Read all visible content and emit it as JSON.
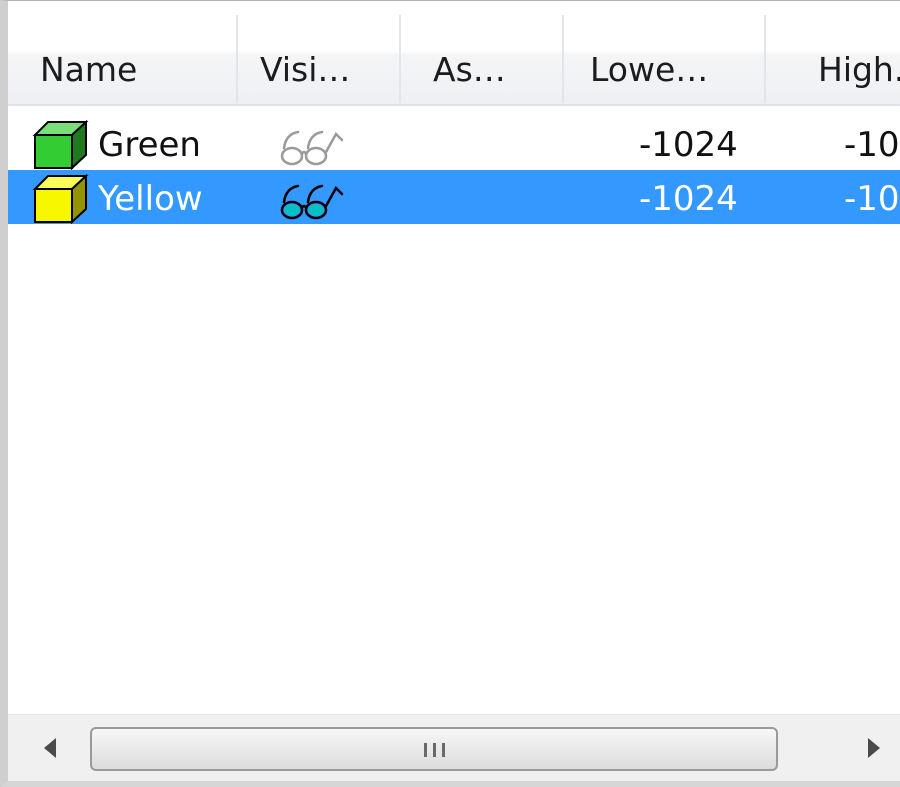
{
  "columns": {
    "name": "Name",
    "visible": "Visi…",
    "assigned": "As…",
    "lower": "Lowe…",
    "higher": "High."
  },
  "rows": [
    {
      "name": "Green",
      "lower": "-1024",
      "higher": "-10",
      "color": "#33cc33",
      "visible": false,
      "selected": false
    },
    {
      "name": "Yellow",
      "lower": "-1024",
      "higher": "-10",
      "color": "#f7f700",
      "visible": true,
      "selected": true
    }
  ],
  "icons": {
    "row_icon": "cube-icon",
    "visibility_icon": "glasses-icon",
    "scroll_left": "arrow-left-icon",
    "scroll_right": "arrow-right-icon",
    "thumb_grip": "grip-icon"
  },
  "colors": {
    "selection": "#3399ff",
    "glasses_active": "#00c0c0"
  },
  "scrollbar": {
    "thumb_fraction": 0.8
  }
}
